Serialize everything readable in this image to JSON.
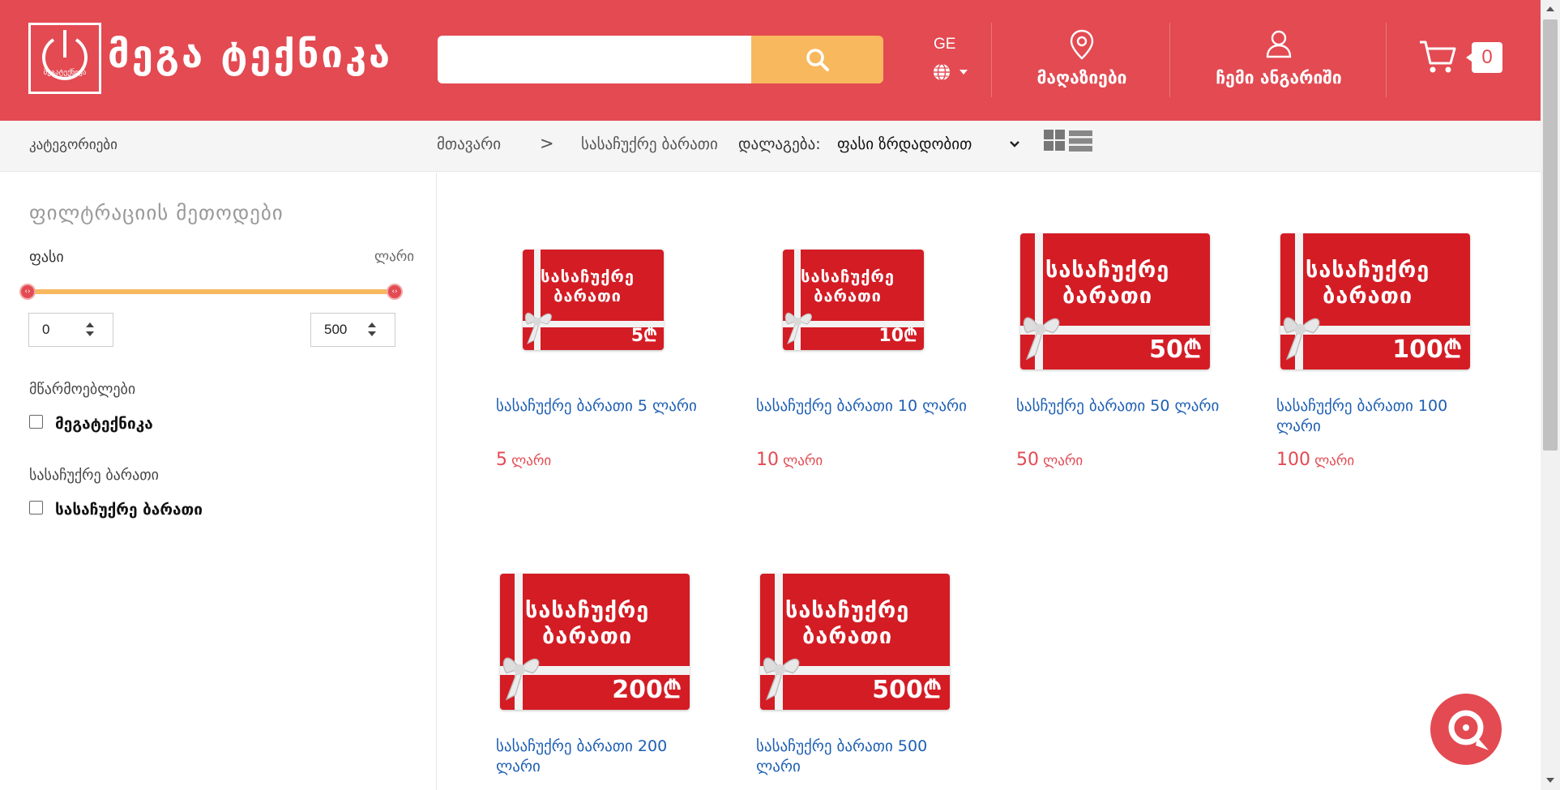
{
  "header": {
    "logo_mini_text": "მეგატექნიკა",
    "logo_text": "მეგა ტექნიკა",
    "search_placeholder": "",
    "lang_code": "GE",
    "stores_label": "მაღაზიები",
    "account_label": "ჩემი ანგარიში",
    "cart_count": "0",
    "brand_color": "#e34a52",
    "search_button_color": "#f8b85e",
    "icons": [
      "search-icon",
      "globe-icon",
      "location-pin-icon",
      "user-icon",
      "cart-icon"
    ]
  },
  "subbar": {
    "categories_label": "კატეგორიები",
    "breadcrumb_home": "მთავარი",
    "breadcrumb_separator": ">",
    "breadcrumb_current": "სასაჩუქრე ბარათი",
    "sort_label": "დალაგება:",
    "sort_value": "ფასი ზრდადობით",
    "icons": [
      "chevron-down-icon",
      "grid-view-icon",
      "list-view-icon"
    ]
  },
  "sidebar": {
    "title": "ფილტრაციის მეთოდები",
    "price_label": "ფასი",
    "currency_label": "ლარი",
    "price_min": "0",
    "price_max": "500",
    "manufacturers_title": "მწარმოებლები",
    "manufacturer_option": "მეგატექნიკა",
    "giftcard_title": "სასაჩუქრე ბარათი",
    "giftcard_option": "სასაჩუქრე ბარათი"
  },
  "products": [
    {
      "name": "სასაჩუქრე ბარათი 5 ლარი",
      "price": "5",
      "currency": "ლარი",
      "card_text": "სასაჩუქრე ბარათი",
      "card_value": "5₾"
    },
    {
      "name": "სასაჩუქრე ბარათი 10 ლარი",
      "price": "10",
      "currency": "ლარი",
      "card_text": "სასაჩუქრე ბარათი",
      "card_value": "10₾"
    },
    {
      "name": "სასჩუქრე ბარათი 50 ლარი",
      "price": "50",
      "currency": "ლარი",
      "card_text": "სასაჩუქრე ბარათი",
      "card_value": "50₾"
    },
    {
      "name": "სასაჩუქრე ბარათი 100 ლარი",
      "price": "100",
      "currency": "ლარი",
      "card_text": "სასაჩუქრე ბარათი",
      "card_value": "100₾"
    },
    {
      "name": "სასაჩუქრე ბარათი 200 ლარი",
      "price": "",
      "currency": "",
      "card_text": "სასაჩუქრე ბარათი",
      "card_value": "200₾"
    },
    {
      "name": "სასაჩუქრე ბარათი 500 ლარი",
      "price": "",
      "currency": "",
      "card_text": "სასაჩუქრე ბარათი",
      "card_value": "500₾"
    }
  ],
  "chat_widget": {
    "icon": "chat-support-icon"
  }
}
